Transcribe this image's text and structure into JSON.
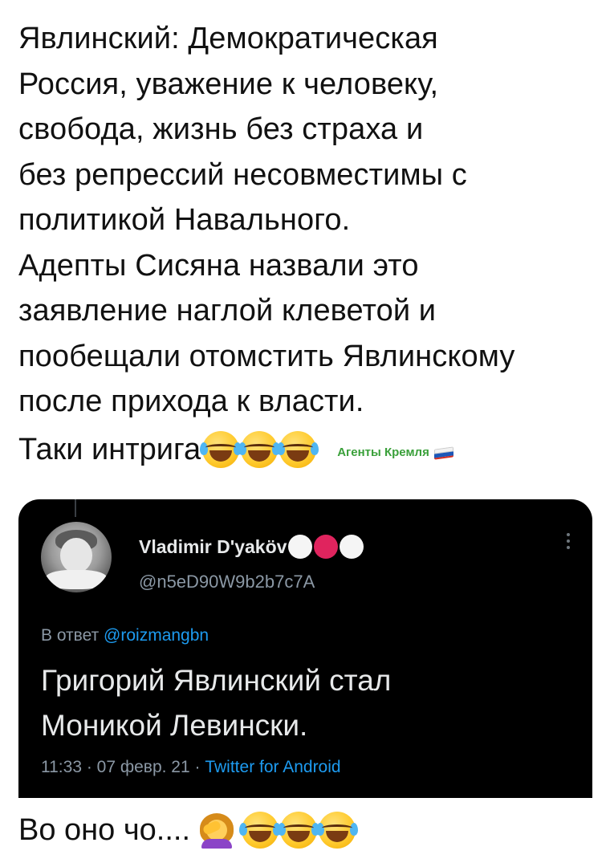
{
  "post": {
    "lines": [
      "Явлинский: Демократическая",
      "Россия, уважение к человеку,",
      "свобода, жизнь без страха и",
      "без репрессий несовместимы с",
      "политикой Навального.",
      "Адепты Сисяна назвали это",
      "заявление наглой клеветой и",
      "пообещали отомстить Явлинскому",
      "после прихода к власти."
    ],
    "tagline": "Таки интрига",
    "tagline_emojis": [
      "face-with-tears-of-joy-icon",
      "face-with-tears-of-joy-icon",
      "face-with-tears-of-joy-icon"
    ],
    "channel_label": "Агенты Кремля",
    "channel_flag": "russia-flag-icon"
  },
  "tweet": {
    "author_name": "Vladimir D'yaköv",
    "name_dots": [
      "white",
      "red",
      "white"
    ],
    "handle": "@n5eD90W9b2b7c7A",
    "reply_prefix": "В ответ",
    "reply_mention": "@roizmangbn",
    "body_lines": [
      "Григорий Явлинский стал",
      "Моникой Левински."
    ],
    "meta_time": "11:33 · 07 февр. 21 ·",
    "meta_source": "Twitter for Android"
  },
  "footer": {
    "text": "Во оно чо....",
    "emojis": [
      "woman-facepalming-icon",
      "face-with-tears-of-joy-icon",
      "face-with-tears-of-joy-icon",
      "face-with-tears-of-joy-icon"
    ]
  },
  "colors": {
    "card_bg": "#000000",
    "link_blue": "#1d9bf0",
    "muted_gray": "#8b98a5",
    "channel_green": "#3aa03a",
    "dot_red": "#e0245e"
  }
}
